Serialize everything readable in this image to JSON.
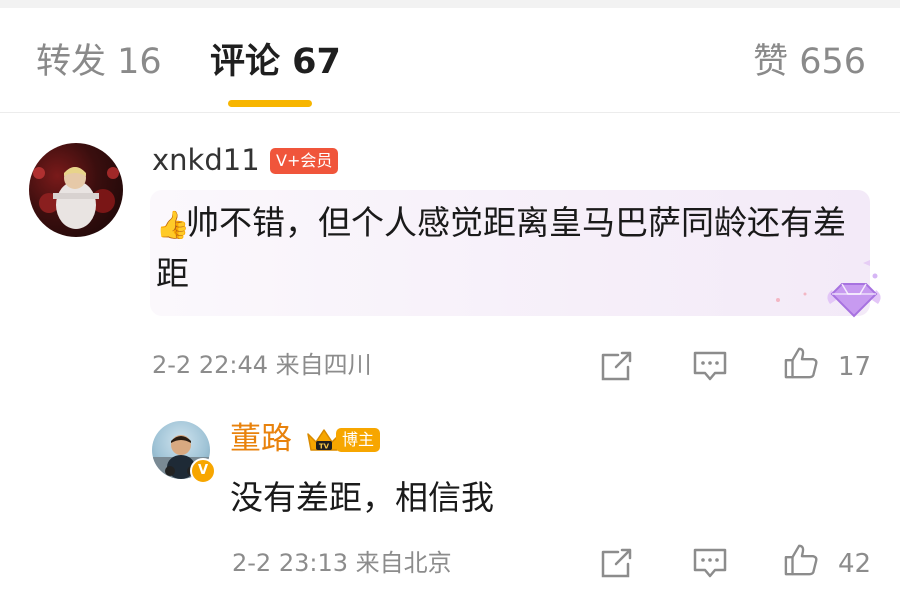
{
  "tabs": {
    "forward": "转发 16",
    "comments": "评论 67",
    "likes": "赞 656"
  },
  "colors": {
    "accent": "#f7b500",
    "vip_badge": "#f0553b",
    "blogger_name": "#e8820c",
    "blogger_badge": "#f7a600",
    "meta_text": "#8c8c8c"
  },
  "comments": [
    {
      "username": "xnkd11",
      "badge": "V+会员",
      "emoji_icon": "thumbs-up-emoji",
      "text": "帅不错，但个人感觉距离皇马巴萨同龄还有差距",
      "meta": "2-2 22:44 来自四川",
      "like_count": "17",
      "reply": {
        "username": "董路",
        "badge": "博主",
        "verified_icon": "verified-v-icon",
        "text": "没有差距，相信我",
        "meta": "2-2 23:13 来自北京",
        "like_count": "42"
      }
    }
  ]
}
